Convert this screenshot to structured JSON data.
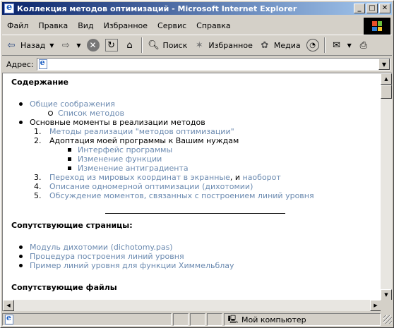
{
  "window": {
    "title": "Коллекция методов оптимизаций - Microsoft Internet Explorer",
    "buttons": {
      "minimize": "_",
      "maximize": "□",
      "close": "✕"
    }
  },
  "menu": [
    {
      "label": "Файл"
    },
    {
      "label": "Правка"
    },
    {
      "label": "Вид"
    },
    {
      "label": "Избранное"
    },
    {
      "label": "Сервис"
    },
    {
      "label": "Справка"
    }
  ],
  "toolbar": {
    "back_label": "Назад",
    "search_label": "Поиск",
    "favorites_label": "Избранное",
    "media_label": "Медиа"
  },
  "address": {
    "label": "Адрес:",
    "value": ""
  },
  "page": {
    "toc_heading": "Содержание",
    "toc": {
      "general": "Общие соображения",
      "methods_list": "Список методов",
      "main_points": "Основные моменты в реализации методов",
      "items": [
        {
          "num": "1.",
          "text": "Методы реализации \"методов оптимизации\""
        },
        {
          "num": "2.",
          "text": "Адоптация моей программы к Вашим нуждам"
        },
        {
          "num": "3.",
          "text": "Переход из мировых координат в экранные",
          "sep": ", и ",
          "text2": "наоборот"
        },
        {
          "num": "4.",
          "text": "Описание одномерной оптимизации (дихотомии)"
        },
        {
          "num": "5.",
          "text": "Обсуждение моментов, связанных с построением линий уровня"
        }
      ],
      "sub_items": [
        "Интерфейс программы",
        "Изменение функции",
        "Изменение антиградиента"
      ]
    },
    "related_pages_heading": "Сопутствующие страницы:",
    "related_pages": [
      "Модуль дихотомии (dichotomy.pas)",
      "Процедура построения линий уровня",
      "Пример линий уровня для функции Химмельблау"
    ],
    "related_files_heading": "Сопутствующие файлы"
  },
  "status": {
    "zone": "Мой компьютер"
  },
  "colors": {
    "title_start": "#0a246a",
    "title_end": "#a6caf0",
    "link": "#6b8ab0",
    "chrome": "#d4d0c8"
  }
}
